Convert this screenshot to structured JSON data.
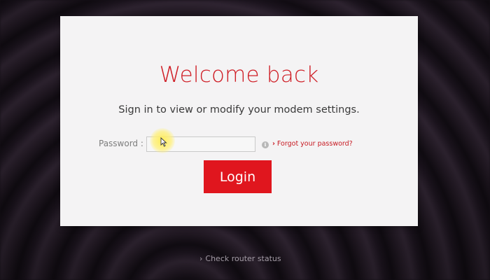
{
  "login": {
    "title": "Welcome back",
    "subtitle": "Sign in to view or modify your modem settings.",
    "password_label": "Password :",
    "password_value": "",
    "forgot_link": "Forgot your password?",
    "login_button": "Login"
  },
  "footer": {
    "status_link": "Check router status"
  },
  "icons": {
    "info": "info-icon",
    "chevron": "chevron-right-icon",
    "cursor": "text-cursor-icon"
  },
  "colors": {
    "accent": "#e0161e",
    "title": "#cf1d25",
    "card_bg": "#f4f3f4",
    "page_bg": "#1e1620"
  }
}
